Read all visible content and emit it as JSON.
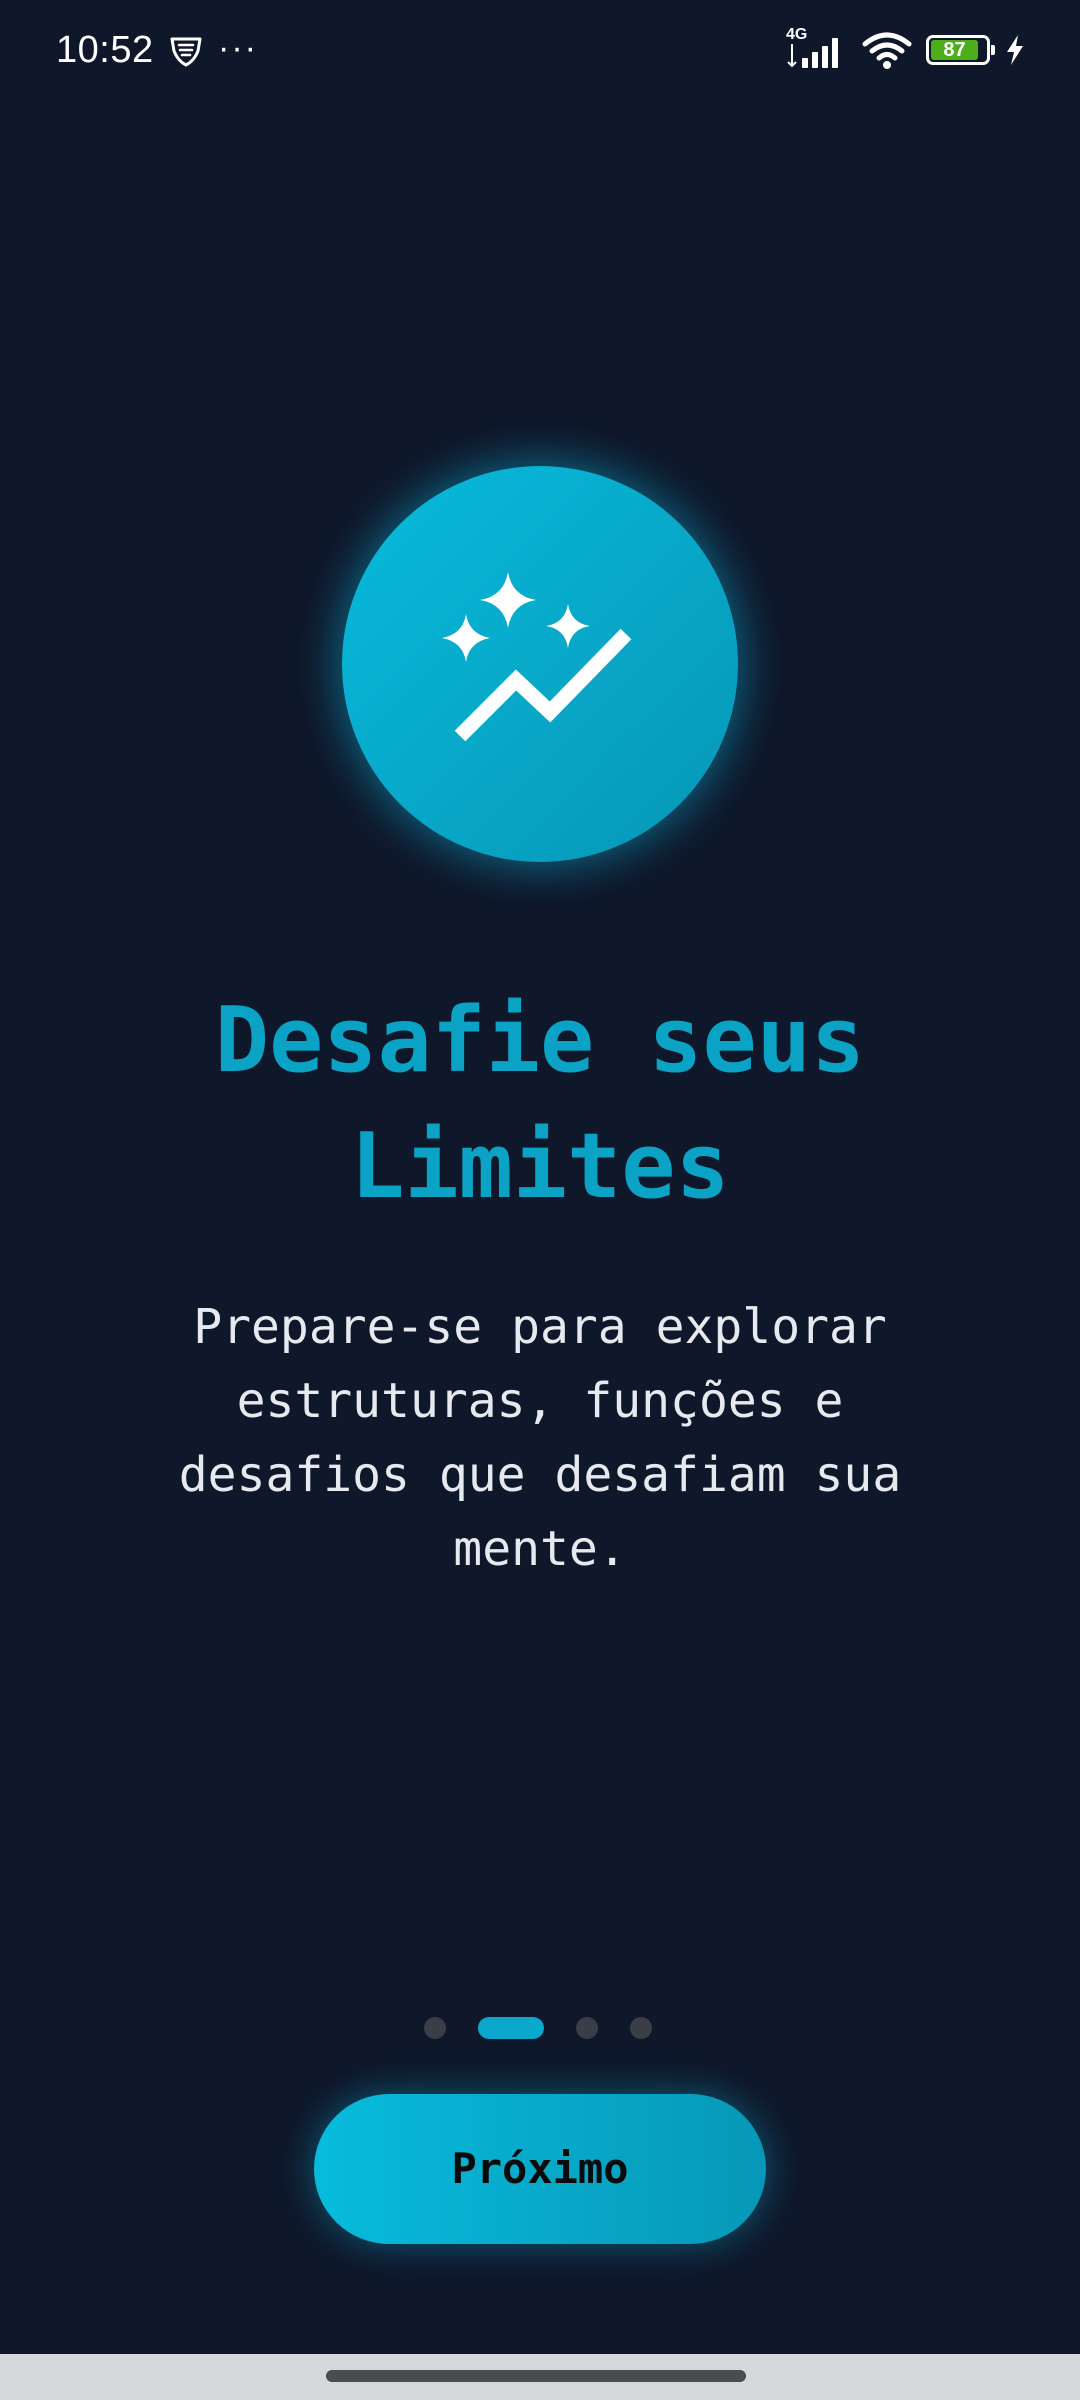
{
  "status_bar": {
    "time": "10:52",
    "more_indicator": "···",
    "network_type": "4G",
    "battery_level": "87",
    "battery_charging": true,
    "icons": [
      "shield-app-icon",
      "signal-icon",
      "wifi-icon",
      "battery-icon",
      "charging-icon"
    ]
  },
  "hero": {
    "icon": "sparkle-trend-icon",
    "colors": {
      "circle_start": "#08bbdc",
      "circle_end": "#0796b6"
    }
  },
  "onboarding": {
    "title": "Desafie seus Limites",
    "description": "Prepare-se para explorar estruturas, funções e desafios que desafiam sua mente."
  },
  "pager": {
    "total_pages": 4,
    "current_page": 2
  },
  "actions": {
    "next_label": "Próximo"
  },
  "colors": {
    "background": "#0f172a",
    "accent": "#0aa3c6",
    "inactive_dot": "#3a3f47"
  }
}
